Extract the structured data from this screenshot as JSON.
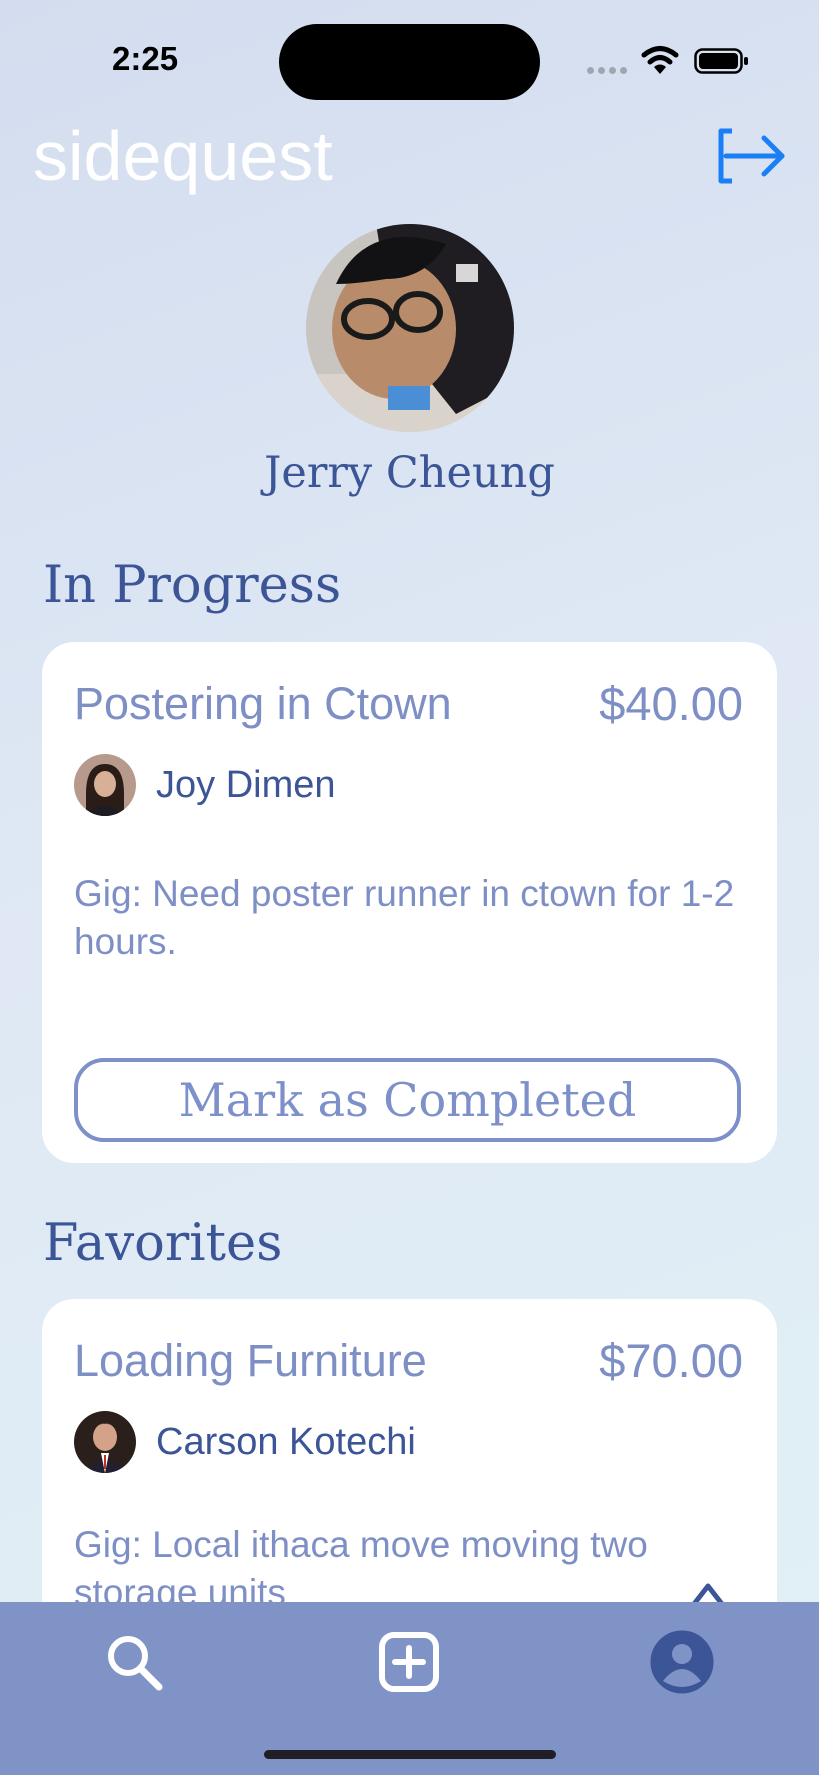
{
  "status_bar": {
    "time": "2:25"
  },
  "header": {
    "logo_text": "sidequest"
  },
  "profile": {
    "name": "Jerry Cheung"
  },
  "in_progress": {
    "title": "In Progress",
    "card": {
      "title": "Postering in Ctown",
      "price": "$40.00",
      "poster_name": "Joy Dimen",
      "description": "Gig: Need poster runner in ctown for 1-2 hours.",
      "action_label": "Mark as Completed"
    }
  },
  "favorites": {
    "title": "Favorites",
    "card": {
      "title": "Loading Furniture",
      "price": "$70.00",
      "poster_name": "Carson Kotechi",
      "description": "Gig: Local ithaca move moving two storage units"
    }
  },
  "tab_bar": {
    "items": [
      "search-icon",
      "add-post-icon",
      "profile-icon"
    ]
  },
  "colors": {
    "primary_text": "#3b5597",
    "secondary_text": "#7d8fc5",
    "tab_bar": "#8093c6",
    "accent_blue": "#1a7ff5"
  }
}
